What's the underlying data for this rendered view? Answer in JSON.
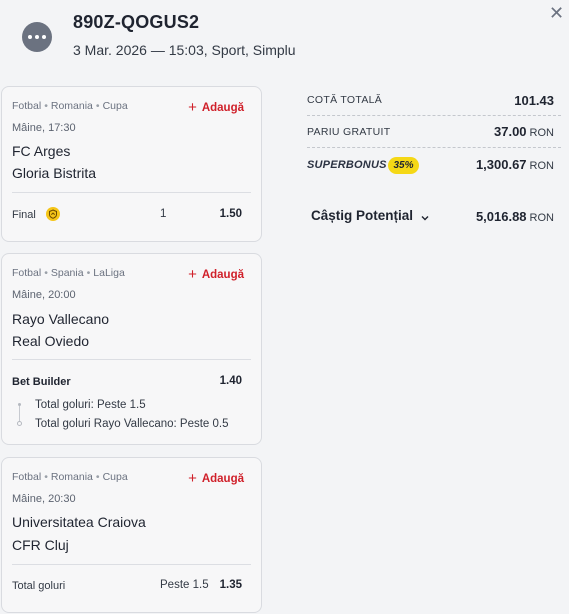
{
  "header": {
    "ticket_code": "890Z-QOGUS2",
    "meta": "3 Mar. 2026 — 15:03, Sport, Simplu",
    "menu_icon": "more-dots-icon",
    "close_icon": "close-icon",
    "close_glyph": "✕"
  },
  "events": [
    {
      "breadcrumb": {
        "sport": "Fotbal",
        "country": "Romania",
        "league": "Cupa"
      },
      "add_label": "Adaugă",
      "time": "Mâine, 17:30",
      "team_home": "FC Arges",
      "team_away": "Gloria Bistrita",
      "market": "Final",
      "market_icon": "shield-chevron-badge-icon",
      "selection": "1",
      "odd": "1.50"
    },
    {
      "breadcrumb": {
        "sport": "Fotbal",
        "country": "Spania",
        "league": "LaLiga"
      },
      "add_label": "Adaugă",
      "time": "Mâine, 20:00",
      "team_home": "Rayo Vallecano",
      "team_away": "Real Oviedo",
      "market": "Bet Builder",
      "odd": "1.40",
      "legs": [
        "Total goluri: Peste 1.5",
        "Total goluri Rayo Vallecano: Peste 0.5"
      ]
    },
    {
      "breadcrumb": {
        "sport": "Fotbal",
        "country": "Romania",
        "league": "Cupa"
      },
      "add_label": "Adaugă",
      "time": "Mâine, 20:30",
      "team_home": "Universitatea Craiova",
      "team_away": "CFR Cluj",
      "market": "Total goluri",
      "selection": "Peste 1.5",
      "odd": "1.35"
    }
  ],
  "summary": {
    "total_odds_label": "COTĂ TOTALĂ",
    "total_odds_value": "101.43",
    "free_bet_label": "PARIU GRATUIT",
    "free_bet_value": "37.00",
    "superbonus_label": "SUPERBONUS",
    "superbonus_pct": "35%",
    "superbonus_value": "1,300.67",
    "potential_label": "Câștig Potențial",
    "potential_value": "5,016.88",
    "currency": "RON"
  },
  "colors": {
    "accent_red": "#d0202a",
    "bonus_yellow": "#f5d816",
    "background": "#f3f4f6"
  }
}
